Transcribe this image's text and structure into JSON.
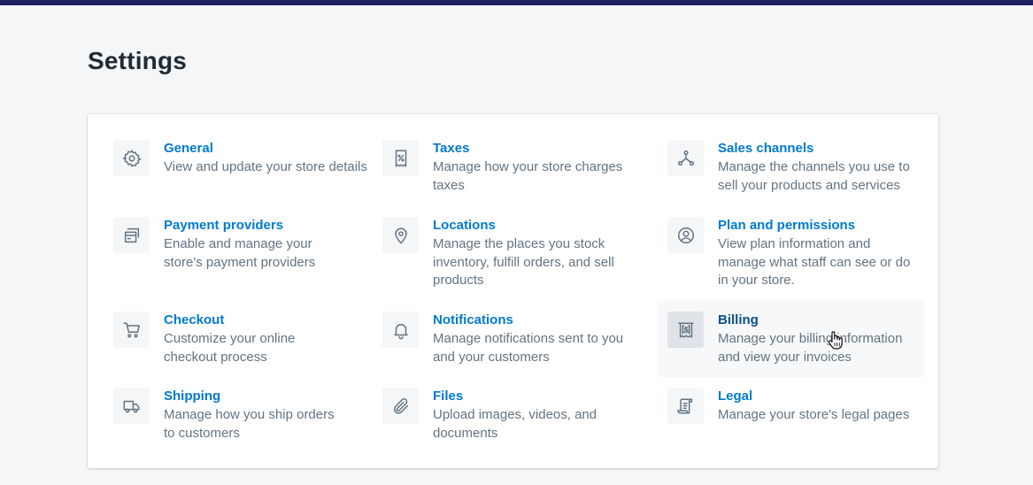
{
  "page": {
    "title": "Settings"
  },
  "colors": {
    "topbar": "#1c2260",
    "link": "#007ace",
    "link_hover": "#084e8a",
    "text_subdued": "#637381"
  },
  "settings": {
    "general": {
      "title": "General",
      "description": "View and update your store details",
      "icon": "gear-icon"
    },
    "taxes": {
      "title": "Taxes",
      "description": "Manage how your store charges taxes",
      "icon": "receipt-percent-icon"
    },
    "sales_channels": {
      "title": "Sales channels",
      "description": "Manage the channels you use to sell your products and services",
      "icon": "channels-icon"
    },
    "payment_providers": {
      "title": "Payment providers",
      "description": "Enable and manage your store's payment providers",
      "icon": "credit-cards-icon"
    },
    "locations": {
      "title": "Locations",
      "description": "Manage the places you stock inventory, fulfill orders, and sell products",
      "icon": "location-pin-icon"
    },
    "plan_permissions": {
      "title": "Plan and permissions",
      "description": "View plan information and manage what staff can see or do in your store.",
      "icon": "user-circle-icon"
    },
    "checkout": {
      "title": "Checkout",
      "description": "Customize your online checkout process",
      "icon": "cart-icon"
    },
    "notifications": {
      "title": "Notifications",
      "description": "Manage notifications sent to you and your customers",
      "icon": "bell-icon"
    },
    "billing": {
      "title": "Billing",
      "description": "Manage your billing information and view your invoices",
      "icon": "dollar-invoice-icon"
    },
    "shipping": {
      "title": "Shipping",
      "description": "Manage how you ship orders to customers",
      "icon": "truck-icon"
    },
    "files": {
      "title": "Files",
      "description": "Upload images, videos, and documents",
      "icon": "paperclip-icon"
    },
    "legal": {
      "title": "Legal",
      "description": "Manage your store's legal pages",
      "icon": "legal-document-icon"
    }
  }
}
